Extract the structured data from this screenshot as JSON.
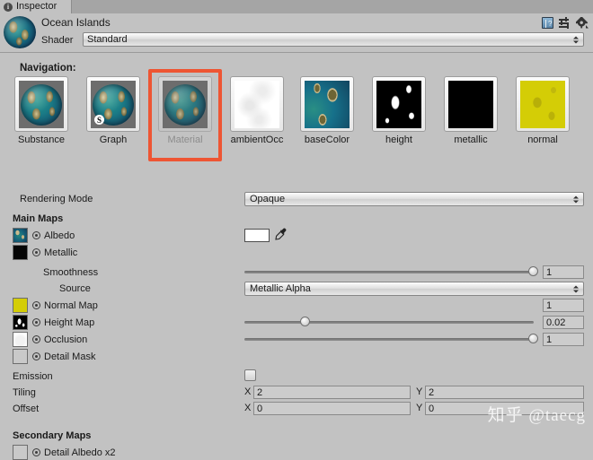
{
  "window": {
    "tab_label": "Inspector",
    "tab_icon": "info-icon",
    "header_icons": [
      {
        "name": "preset-book-icon",
        "glyph": "book"
      },
      {
        "name": "preset-settings-icon",
        "glyph": "sliders"
      },
      {
        "name": "gear-icon",
        "glyph": "gear"
      }
    ]
  },
  "material": {
    "name": "Ocean Islands",
    "preview_icon": "material-sphere-preview",
    "shader_label": "Shader",
    "shader_value": "Standard"
  },
  "navigation": {
    "title": "Navigation:",
    "selected": "Material",
    "annotation_color": "#ee5533",
    "items": [
      {
        "label": "Substance",
        "thumb": "sphere",
        "selected": false,
        "badge": null
      },
      {
        "label": "Graph",
        "thumb": "sphere",
        "selected": false,
        "badge": "S"
      },
      {
        "label": "Material",
        "thumb": "sphere-faded",
        "selected": true,
        "badge": null
      },
      {
        "label": "ambientOcc",
        "thumb": "texture-ambient-occlusion",
        "selected": false,
        "badge": null
      },
      {
        "label": "baseColor",
        "thumb": "texture-base-color",
        "selected": false,
        "badge": null
      },
      {
        "label": "height",
        "thumb": "texture-height",
        "selected": false,
        "badge": null
      },
      {
        "label": "metallic",
        "thumb": "texture-metallic",
        "selected": false,
        "badge": null
      },
      {
        "label": "normal",
        "thumb": "texture-normal",
        "selected": false,
        "badge": null
      }
    ]
  },
  "properties": {
    "rendering_mode_label": "Rendering Mode",
    "rendering_mode_value": "Opaque",
    "main_maps_header": "Main Maps",
    "albedo_label": "Albedo",
    "albedo_color": "#ffffff",
    "metallic_label": "Metallic",
    "smoothness_label": "Smoothness",
    "smoothness_value": "1",
    "source_label": "Source",
    "source_value": "Metallic Alpha",
    "normal_map_label": "Normal Map",
    "normal_map_value": "1",
    "height_map_label": "Height Map",
    "height_map_value": "0.02",
    "occlusion_label": "Occlusion",
    "occlusion_value": "1",
    "detail_mask_label": "Detail Mask",
    "emission_label": "Emission",
    "tiling_label": "Tiling",
    "tiling_x": "2",
    "tiling_y": "2",
    "offset_label": "Offset",
    "offset_x": "0",
    "offset_y": "0",
    "axis_x": "X",
    "axis_y": "Y",
    "secondary_maps_header": "Secondary Maps",
    "detail_albedo_label": "Detail Albedo x2"
  },
  "watermark": "知乎 @taecg"
}
